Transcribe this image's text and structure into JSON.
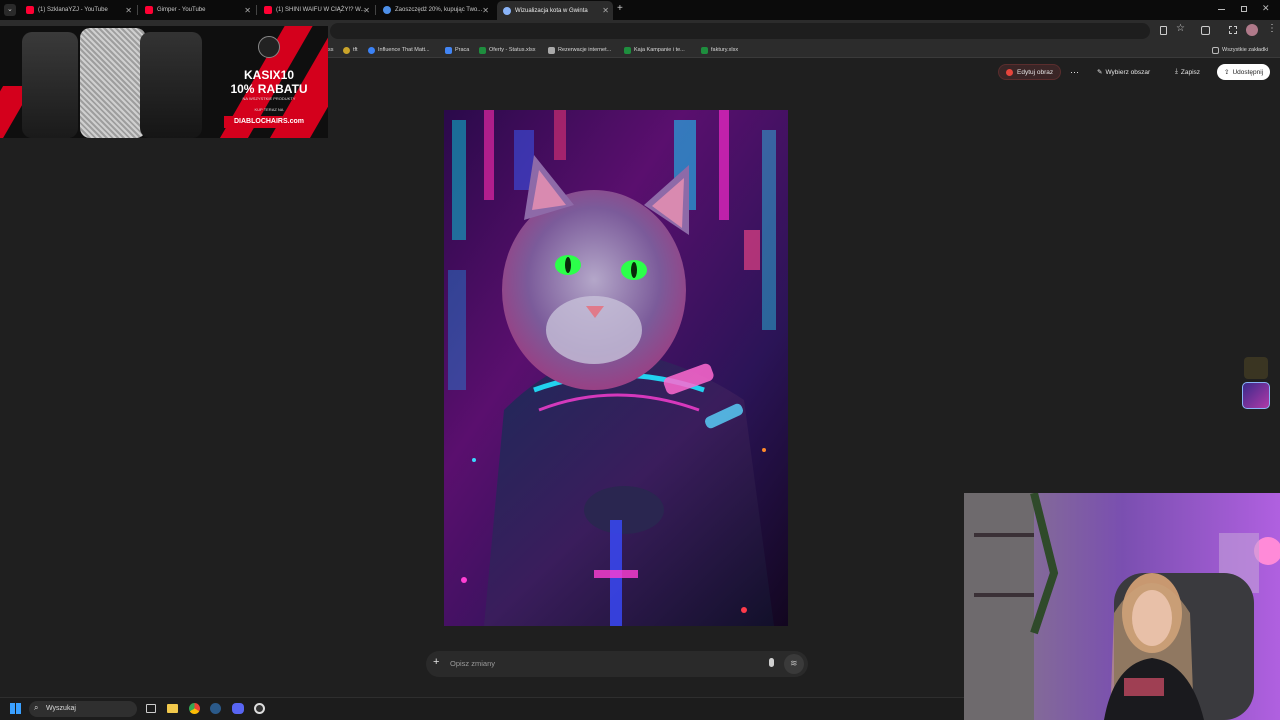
{
  "browser": {
    "tabs": [
      {
        "label": "(1) SzklanaYZJ - YouTube",
        "color": "#ff0033"
      },
      {
        "label": "Gimper - YouTube",
        "color": "#ff0033"
      },
      {
        "label": "(1) SHINI WAIFU W CIĄŻY!? W...",
        "color": "#ff0033"
      },
      {
        "label": "Zaoszczędź 20%, kupując Two...",
        "color": "#4d8fe8"
      },
      {
        "label": "Wizualizacja kota w Gwinta",
        "color": "#8ab4f8"
      }
    ],
    "new_tab": "+",
    "bookmarks": [
      {
        "label": "ss",
        "color": "#777777"
      },
      {
        "label": "tft",
        "color": "#caa42a"
      },
      {
        "label": "Influence That Matt...",
        "color": "#3b82f6"
      },
      {
        "label": "Praca",
        "color": "#4285f4"
      },
      {
        "label": "Oferty - Status.xlsx",
        "color": "#1e8e3e"
      },
      {
        "label": "Rezerwacje internet...",
        "color": "#aaaaaa"
      },
      {
        "label": "Kaja Kampanie i te...",
        "color": "#1e8e3e"
      },
      {
        "label": "faktury.xlsx",
        "color": "#1e8e3e"
      }
    ],
    "all_bookmarks": "Wszystkie zakładki"
  },
  "ad": {
    "brand": "DIABLO",
    "headline1": "KASIX10",
    "headline2": "10% RABATU",
    "sub": "NA WSZYSTKIE PRODUKTY",
    "buy": "KUP TERAZ NA",
    "site": "DIABLOCHAIRS.com"
  },
  "actions": {
    "edit": "Edytuj obraz",
    "more": "⋯",
    "select_area": "Wybierz obszar",
    "save": "Zapisz",
    "share": "Udostępnij"
  },
  "prompt": {
    "placeholder": "Opisz zmiany"
  },
  "taskbar": {
    "search": "Wyszukaj"
  },
  "colors": {
    "accent": "#e8453c",
    "background": "#1f1f1f",
    "ad_red": "#d4001c"
  }
}
